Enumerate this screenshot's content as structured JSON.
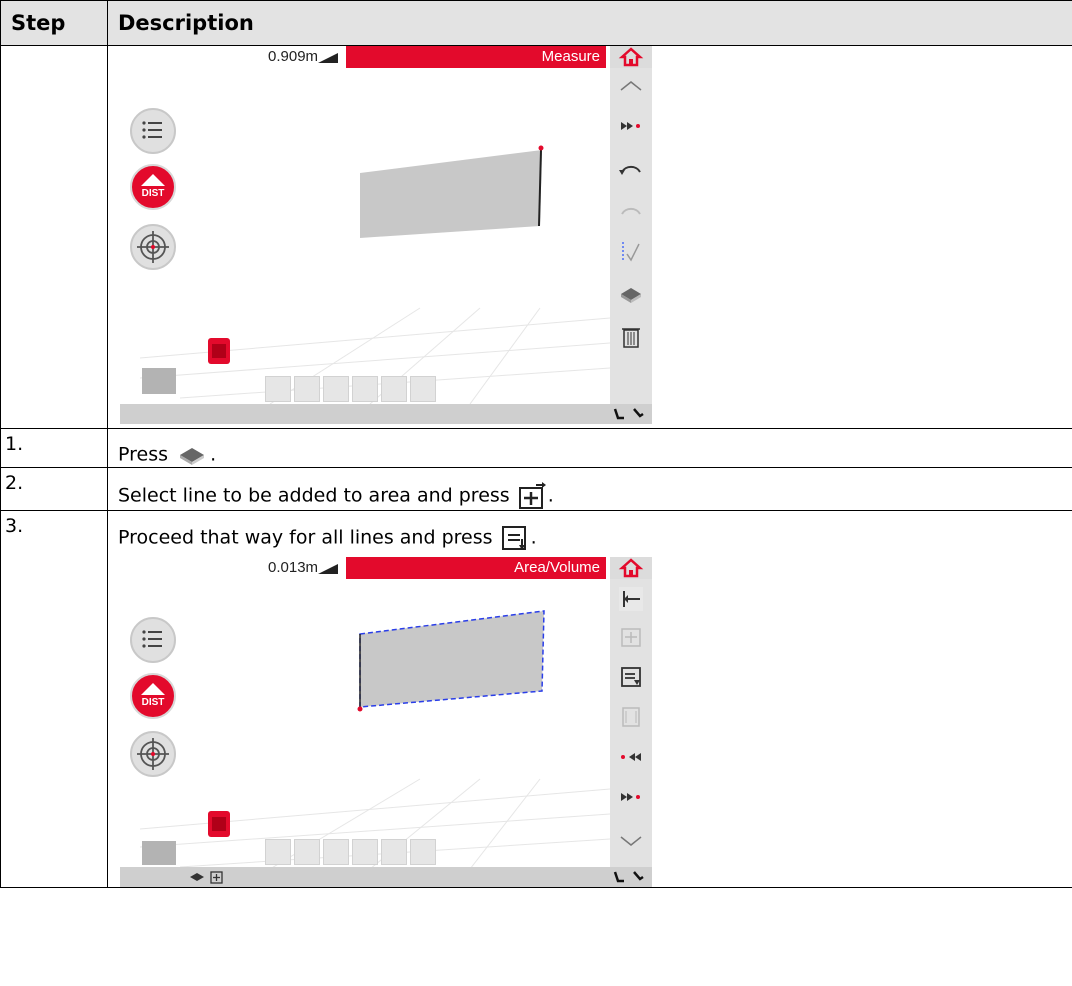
{
  "table": {
    "col_step": "Step",
    "col_description": "Description",
    "rows": [
      {
        "step": "1.",
        "before": "Press",
        "after": ".",
        "icon": "area-volume-icon"
      },
      {
        "step": "2.",
        "before": "Select line to be added to area and press",
        "after": ".",
        "icon": "add-line-icon"
      },
      {
        "step": "3.",
        "before": "Proceed that way for all lines and press",
        "after": ".",
        "icon": "finish-list-icon"
      }
    ]
  },
  "screen1": {
    "distance": "0.909m",
    "title": "Measure",
    "dist_label": "DIST"
  },
  "screen2": {
    "distance": "0.013m",
    "title": "Area/Volume",
    "dist_label": "DIST"
  },
  "colors": {
    "accent_red": "#e30a2c",
    "toolbar_gray": "#e2e2e2",
    "header_gray": "#e3e3e3"
  }
}
